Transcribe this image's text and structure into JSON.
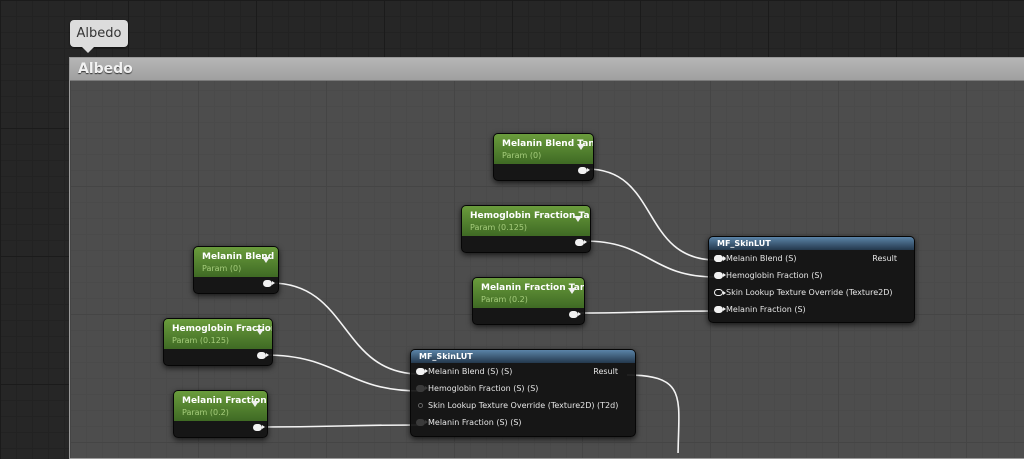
{
  "comment": {
    "bubble_label": "Albedo",
    "title": "Albedo"
  },
  "params": {
    "melanin_blend_tan": {
      "title": "Melanin Blend Tan",
      "subtitle": "Param (0)"
    },
    "hemoglobin_fraction_tan": {
      "title": "Hemoglobin Fraction  Tan",
      "subtitle": "Param (0.125)"
    },
    "melanin_fraction_tan": {
      "title": "Melanin Fraction  Tan",
      "subtitle": "Param (0.2)"
    },
    "melanin_blend": {
      "title": "Melanin Blend",
      "subtitle": "Param (0)"
    },
    "hemoglobin_fraction": {
      "title": "Hemoglobin Fraction",
      "subtitle": "Param (0.125)"
    },
    "melanin_fraction": {
      "title": "Melanin Fraction",
      "subtitle": "Param (0.2)"
    }
  },
  "func_top": {
    "title": "MF_SkinLUT",
    "inputs": [
      "Melanin Blend (S)",
      "Hemoglobin Fraction (S)",
      "Skin Lookup Texture Override (Texture2D)",
      "Melanin Fraction (S)"
    ],
    "output": "Result"
  },
  "func_bottom": {
    "title": "MF_SkinLUT",
    "inputs": [
      "Melanin Blend (S) (S)",
      "Hemoglobin Fraction (S) (S)",
      "Skin Lookup Texture Override (Texture2D) (T2d)",
      "Melanin Fraction (S) (S)"
    ],
    "output": "Result"
  }
}
